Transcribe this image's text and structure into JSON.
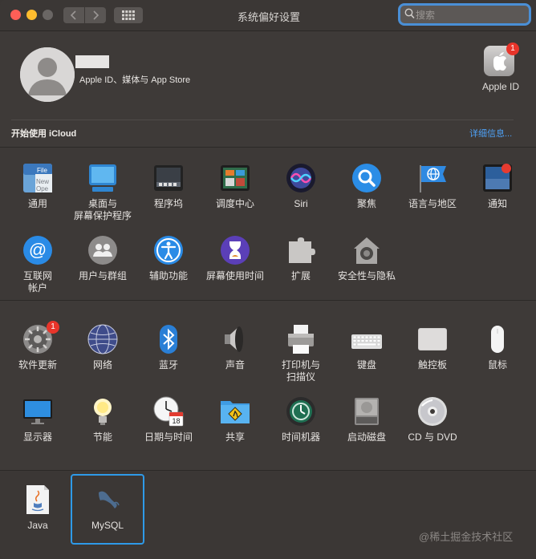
{
  "window": {
    "title": "系统偏好设置",
    "search_placeholder": "搜索"
  },
  "account": {
    "subtitle": "Apple ID、媒体与 App Store",
    "apple_id_label": "Apple ID",
    "apple_id_badge": "1"
  },
  "icloud": {
    "label": "开始使用 iCloud",
    "link": "详细信息..."
  },
  "section1": {
    "row1": [
      {
        "label": "通用",
        "icon": "general-icon"
      },
      {
        "label": "桌面与\n屏幕保护程序",
        "icon": "desktop-screensaver-icon"
      },
      {
        "label": "程序坞",
        "icon": "dock-icon"
      },
      {
        "label": "调度中心",
        "icon": "mission-control-icon"
      },
      {
        "label": "Siri",
        "icon": "siri-icon"
      },
      {
        "label": "聚焦",
        "icon": "spotlight-icon"
      },
      {
        "label": "语言与地区",
        "icon": "language-region-icon"
      },
      {
        "label": "通知",
        "icon": "notifications-icon"
      }
    ],
    "row2": [
      {
        "label": "互联网\n帐户",
        "icon": "internet-accounts-icon"
      },
      {
        "label": "用户与群组",
        "icon": "users-groups-icon"
      },
      {
        "label": "辅助功能",
        "icon": "accessibility-icon"
      },
      {
        "label": "屏幕使用时间",
        "icon": "screen-time-icon"
      },
      {
        "label": "扩展",
        "icon": "extensions-icon"
      },
      {
        "label": "安全性与隐私",
        "icon": "security-privacy-icon"
      }
    ]
  },
  "section2": {
    "row1": [
      {
        "label": "软件更新",
        "icon": "software-update-icon",
        "badge": "1"
      },
      {
        "label": "网络",
        "icon": "network-icon"
      },
      {
        "label": "蓝牙",
        "icon": "bluetooth-icon"
      },
      {
        "label": "声音",
        "icon": "sound-icon"
      },
      {
        "label": "打印机与\n扫描仪",
        "icon": "printers-scanners-icon"
      },
      {
        "label": "键盘",
        "icon": "keyboard-icon"
      },
      {
        "label": "触控板",
        "icon": "trackpad-icon"
      },
      {
        "label": "鼠标",
        "icon": "mouse-icon"
      }
    ],
    "row2": [
      {
        "label": "显示器",
        "icon": "displays-icon"
      },
      {
        "label": "节能",
        "icon": "energy-saver-icon"
      },
      {
        "label": "日期与时间",
        "icon": "date-time-icon"
      },
      {
        "label": "共享",
        "icon": "sharing-icon"
      },
      {
        "label": "时间机器",
        "icon": "time-machine-icon"
      },
      {
        "label": "启动磁盘",
        "icon": "startup-disk-icon"
      },
      {
        "label": "CD 与 DVD",
        "icon": "cd-dvd-icon"
      }
    ]
  },
  "section3": [
    {
      "label": "Java",
      "icon": "java-icon"
    },
    {
      "label": "MySQL",
      "icon": "mysql-icon",
      "selected": true
    }
  ],
  "watermark": "@稀土掘金技术社区"
}
